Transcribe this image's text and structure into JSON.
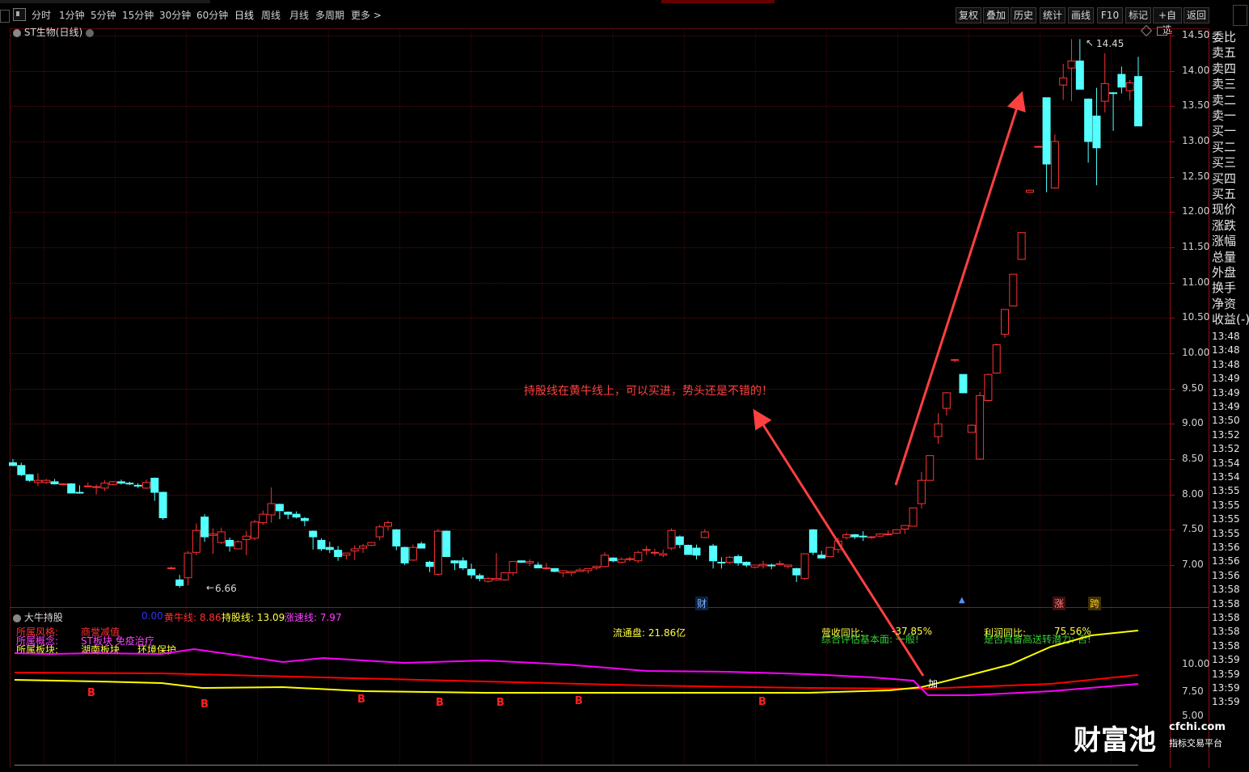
{
  "toolbar": {
    "periods": [
      "分时",
      "1分钟",
      "5分钟",
      "15分钟",
      "30分钟",
      "60分钟",
      "日线",
      "周线",
      "月线",
      "多周期",
      "更多 >"
    ],
    "active_period": "日线",
    "right_buttons": [
      "复权",
      "叠加",
      "历史",
      "统计",
      "画线",
      "F10",
      "标记",
      "+自选",
      "返回"
    ]
  },
  "chart": {
    "title": "ST生物(日线)",
    "high_label": "14.45",
    "low_label": "6.66",
    "event_marks": [
      "财",
      "涨",
      "跨"
    ],
    "annotation": "持股线在黄牛线上，可以买进，势头还是不错的！"
  },
  "price_axis": [
    "14.50",
    "14.00",
    "13.50",
    "13.00",
    "12.50",
    "12.00",
    "11.50",
    "11.00",
    "10.50",
    "10.00",
    "9.50",
    "9.00",
    "8.50",
    "8.00",
    "7.50",
    "7.00"
  ],
  "quote_labels": [
    "委比",
    "卖五",
    "卖四",
    "卖三",
    "卖二",
    "卖一",
    "买一",
    "买二",
    "买三",
    "买四",
    "买五",
    "现价",
    "涨跌",
    "涨幅",
    "总量",
    "外盘",
    "换手",
    "净资",
    "收益(-)"
  ],
  "time_list": [
    "13:48",
    "13:48",
    "13:48",
    "13:49",
    "13:49",
    "13:49",
    "13:50",
    "13:52",
    "13:52",
    "13:54",
    "13:54",
    "13:55",
    "13:55",
    "13:55",
    "13:55",
    "13:56",
    "13:56",
    "13:56",
    "13:58",
    "13:58",
    "13:58",
    "13:58",
    "13:58",
    "13:59",
    "13:59",
    "13:59",
    "13:59"
  ],
  "indicator": {
    "name": "大牛持股",
    "value0": "0.00",
    "yellow_label": "黄牛线: 8.86",
    "hold_label": "持股线: 13.09",
    "speed_label": "涨速线: 7.97",
    "style_key": "所属风格:",
    "style_val": "商誉减值",
    "concept_key": "所属概念:",
    "concept_val": "ST板块 免疫治疗",
    "sector_key": "所属板块:",
    "sector_val1": "湖南板块",
    "sector_val2": "环境保护",
    "float_cap": "流通盘: 21.86亿",
    "rev_yoy": "营收同比:",
    "rev_val": "-37.85%",
    "profit_yoy": "利润同比:",
    "profit_val": "75.56%",
    "eval": "综合评估基本面: 一般!",
    "transfer": "是否具备高送转潜力: 否!",
    "add_mark": "加",
    "b_mark": "B",
    "axis": [
      "10.00",
      "7.50",
      "5.00"
    ]
  },
  "watermark": {
    "brand": "财富池",
    "site": "cfchi.com",
    "slogan": "指标交易平台"
  },
  "colors": {
    "up": "#ff3232",
    "down": "#54ffff",
    "yellow": "#ffff00",
    "red_line": "#ff0000",
    "magenta": "#ff00ff",
    "arrow": "#ff4040"
  },
  "chart_data": {
    "type": "candlestick",
    "ohlc": [
      [
        8.45,
        8.5,
        8.4,
        8.41
      ],
      [
        8.41,
        8.45,
        8.26,
        8.28
      ],
      [
        8.28,
        8.29,
        8.18,
        8.2
      ],
      [
        8.17,
        8.3,
        8.12,
        8.2
      ],
      [
        8.17,
        8.22,
        8.15,
        8.2
      ],
      [
        8.18,
        8.22,
        8.14,
        8.15
      ],
      [
        8.15,
        8.16,
        8.13,
        8.15
      ],
      [
        8.15,
        8.16,
        8.05,
        8.02
      ],
      [
        8.03,
        8.13,
        8.01,
        8.02
      ],
      [
        8.12,
        8.17,
        8.11,
        8.12
      ],
      [
        8.11,
        8.14,
        8.0,
        8.11
      ],
      [
        8.09,
        8.2,
        8.05,
        8.16
      ],
      [
        8.14,
        8.19,
        8.13,
        8.18
      ],
      [
        8.18,
        8.21,
        8.14,
        8.16
      ],
      [
        8.16,
        8.18,
        8.13,
        8.15
      ],
      [
        8.13,
        8.16,
        8.09,
        8.12
      ],
      [
        8.09,
        8.21,
        8.08,
        8.17
      ],
      [
        8.23,
        8.24,
        7.91,
        8.03
      ],
      [
        8.03,
        8.04,
        7.64,
        7.67
      ],
      [
        6.96,
        6.98,
        6.94,
        6.96
      ],
      [
        6.79,
        6.86,
        6.68,
        6.71
      ],
      [
        6.82,
        7.2,
        6.71,
        7.17
      ],
      [
        7.18,
        7.59,
        7.14,
        7.49
      ],
      [
        7.68,
        7.72,
        7.33,
        7.4
      ],
      [
        7.42,
        7.52,
        7.16,
        7.44
      ],
      [
        7.32,
        7.53,
        7.3,
        7.47
      ],
      [
        7.35,
        7.39,
        7.19,
        7.27
      ],
      [
        7.23,
        7.35,
        7.23,
        7.33
      ],
      [
        7.36,
        7.48,
        7.14,
        7.41
      ],
      [
        7.38,
        7.64,
        7.35,
        7.61
      ],
      [
        7.6,
        7.77,
        7.57,
        7.72
      ],
      [
        7.71,
        8.1,
        7.6,
        7.87
      ],
      [
        7.86,
        7.87,
        7.65,
        7.77
      ],
      [
        7.75,
        7.76,
        7.65,
        7.72
      ],
      [
        7.72,
        7.76,
        7.66,
        7.68
      ],
      [
        7.66,
        7.68,
        7.55,
        7.63
      ],
      [
        7.48,
        7.49,
        7.22,
        7.4
      ],
      [
        7.35,
        7.38,
        7.2,
        7.23
      ],
      [
        7.25,
        7.33,
        7.17,
        7.22
      ],
      [
        7.21,
        7.27,
        7.06,
        7.12
      ],
      [
        7.14,
        7.16,
        7.08,
        7.17
      ],
      [
        7.2,
        7.28,
        7.07,
        7.23
      ],
      [
        7.24,
        7.3,
        7.17,
        7.27
      ],
      [
        7.28,
        7.31,
        7.27,
        7.32
      ],
      [
        7.4,
        7.57,
        7.35,
        7.54
      ],
      [
        7.55,
        7.63,
        7.49,
        7.6
      ],
      [
        7.5,
        7.51,
        7.21,
        7.27
      ],
      [
        7.25,
        7.26,
        7.0,
        7.03
      ],
      [
        7.07,
        7.29,
        7.06,
        7.25
      ],
      [
        7.3,
        7.33,
        7.26,
        7.24
      ],
      [
        7.04,
        7.06,
        6.9,
        6.98
      ],
      [
        6.87,
        7.51,
        6.85,
        7.48
      ],
      [
        7.48,
        7.49,
        7.12,
        7.12
      ],
      [
        7.06,
        7.07,
        6.93,
        7.03
      ],
      [
        7.06,
        7.11,
        6.93,
        6.96
      ],
      [
        6.94,
        7.02,
        6.81,
        6.86
      ],
      [
        6.85,
        6.88,
        6.77,
        6.81
      ],
      [
        6.77,
        6.83,
        6.75,
        6.81
      ],
      [
        6.79,
        7.17,
        6.78,
        6.81
      ],
      [
        6.79,
        6.89,
        6.78,
        6.89
      ],
      [
        6.89,
        7.02,
        6.85,
        7.05
      ],
      [
        7.06,
        7.06,
        7.03,
        7.04
      ],
      [
        7.03,
        7.08,
        6.98,
        7.05
      ],
      [
        7.0,
        7.04,
        7.0,
        6.96
      ],
      [
        6.96,
        7.03,
        6.93,
        6.96
      ],
      [
        6.95,
        6.95,
        6.9,
        6.91
      ],
      [
        6.89,
        6.92,
        6.83,
        6.92
      ],
      [
        6.89,
        6.91,
        6.84,
        6.91
      ],
      [
        6.91,
        6.96,
        6.91,
        6.93
      ],
      [
        6.92,
        6.94,
        6.88,
        6.95
      ],
      [
        6.96,
        6.99,
        6.93,
        6.98
      ],
      [
        6.98,
        7.18,
        6.97,
        7.14
      ],
      [
        7.1,
        7.11,
        7.04,
        7.06
      ],
      [
        7.04,
        7.11,
        7.03,
        7.08
      ],
      [
        7.08,
        7.12,
        7.05,
        7.09
      ],
      [
        7.06,
        7.2,
        7.03,
        7.18
      ],
      [
        7.22,
        7.27,
        7.14,
        7.22
      ],
      [
        7.18,
        7.23,
        7.13,
        7.18
      ],
      [
        7.14,
        7.22,
        7.11,
        7.16
      ],
      [
        7.24,
        7.52,
        7.21,
        7.49
      ],
      [
        7.4,
        7.42,
        7.24,
        7.29
      ],
      [
        7.28,
        7.29,
        7.15,
        7.15
      ],
      [
        7.24,
        7.29,
        7.08,
        7.14
      ],
      [
        7.39,
        7.51,
        7.38,
        7.47
      ],
      [
        7.27,
        7.3,
        6.95,
        7.06
      ],
      [
        7.04,
        7.11,
        6.95,
        7.03
      ],
      [
        7.04,
        7.13,
        7.01,
        7.11
      ],
      [
        7.12,
        7.15,
        6.99,
        7.03
      ],
      [
        7.04,
        7.05,
        6.97,
        7.0
      ],
      [
        6.97,
        6.99,
        6.95,
        7.0
      ],
      [
        6.99,
        7.06,
        6.95,
        7.01
      ],
      [
        7.0,
        7.02,
        6.94,
        6.99
      ],
      [
        7.02,
        7.06,
        7.0,
        7.02
      ],
      [
        6.98,
        6.99,
        6.95,
        7.0
      ],
      [
        6.95,
        6.96,
        6.76,
        6.86
      ],
      [
        6.81,
        7.13,
        6.79,
        7.16
      ],
      [
        7.5,
        7.51,
        7.14,
        7.18
      ],
      [
        7.14,
        7.2,
        7.12,
        7.1
      ],
      [
        7.12,
        7.17,
        7.12,
        7.25
      ],
      [
        7.22,
        7.39,
        7.17,
        7.34
      ],
      [
        7.39,
        7.46,
        7.36,
        7.43
      ],
      [
        7.43,
        7.44,
        7.37,
        7.4
      ],
      [
        7.41,
        7.48,
        7.34,
        7.4
      ],
      [
        7.39,
        7.41,
        7.37,
        7.4
      ],
      [
        7.41,
        7.45,
        7.4,
        7.44
      ],
      [
        7.44,
        7.49,
        7.42,
        7.44
      ],
      [
        7.45,
        7.51,
        7.44,
        7.5
      ],
      [
        7.51,
        7.53,
        7.44,
        7.56
      ],
      [
        7.55,
        7.79,
        7.55,
        7.81
      ],
      [
        7.87,
        8.32,
        7.8,
        8.2
      ],
      [
        8.2,
        8.55,
        8.2,
        8.55
      ],
      [
        8.82,
        9.15,
        8.72,
        9.0
      ],
      [
        9.22,
        9.45,
        9.12,
        9.44
      ],
      [
        9.9,
        9.92,
        9.87,
        9.91
      ],
      [
        9.7,
        9.7,
        9.62,
        9.44
      ],
      [
        8.88,
        8.99,
        8.88,
        8.98
      ],
      [
        8.5,
        9.45,
        8.49,
        9.4
      ],
      [
        9.33,
        9.71,
        9.32,
        9.7
      ],
      [
        9.72,
        10.14,
        9.71,
        10.12
      ],
      [
        10.27,
        10.56,
        10.22,
        10.62
      ],
      [
        10.67,
        11.12,
        10.67,
        11.12
      ],
      [
        11.33,
        11.71,
        11.33,
        11.71
      ],
      [
        12.28,
        12.3,
        12.27,
        12.31
      ],
      [
        12.92,
        12.94,
        12.91,
        12.93
      ],
      [
        13.62,
        13.62,
        12.28,
        12.68
      ],
      [
        12.34,
        13.1,
        12.33,
        13.0
      ],
      [
        13.8,
        14.1,
        13.59,
        13.9
      ],
      [
        14.04,
        14.45,
        13.57,
        14.14
      ],
      [
        14.14,
        14.45,
        13.79,
        13.74
      ],
      [
        13.6,
        13.61,
        12.7,
        13.0
      ],
      [
        13.36,
        13.76,
        12.38,
        12.91
      ],
      [
        13.57,
        14.25,
        13.41,
        13.82
      ],
      [
        13.69,
        13.7,
        13.15,
        13.68
      ],
      [
        13.95,
        14.06,
        13.68,
        13.77
      ],
      [
        13.72,
        13.87,
        13.58,
        13.83
      ],
      [
        13.92,
        14.2,
        13.32,
        13.22
      ]
    ],
    "ylim": [
      6.5,
      14.6
    ]
  }
}
